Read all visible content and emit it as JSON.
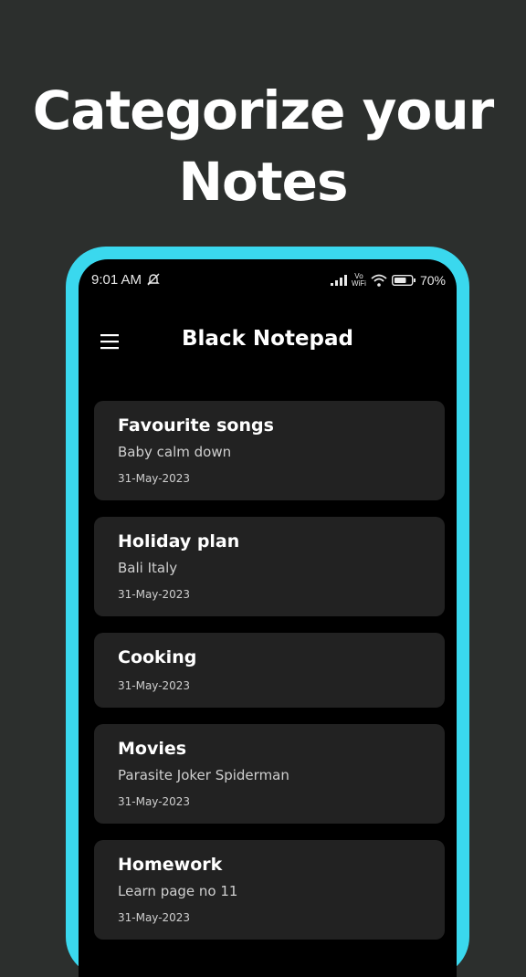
{
  "headline": {
    "line1": "Categorize your",
    "line2": "Notes"
  },
  "status": {
    "time": "9:01 AM",
    "vowifi_top": "Vo",
    "vowifi_bottom": "WiFi",
    "battery": "70%"
  },
  "app": {
    "title": "Black Notepad"
  },
  "notes": [
    {
      "title": "Favourite songs",
      "body": "Baby calm down",
      "date": "31-May-2023"
    },
    {
      "title": "Holiday plan",
      "body": "Bali Italy",
      "date": "31-May-2023"
    },
    {
      "title": "Cooking",
      "body": "",
      "date": "31-May-2023"
    },
    {
      "title": "Movies",
      "body": "Parasite Joker Spiderman",
      "date": "31-May-2023"
    },
    {
      "title": "Homework",
      "body": "Learn page no 11",
      "date": "31-May-2023"
    }
  ],
  "colors": {
    "background": "#2c2f2d",
    "phone_frame": "#3ad8ee",
    "card": "#222222",
    "screen": "#000000"
  },
  "icons": {
    "menu": "hamburger-menu-icon",
    "mute": "bell-off-icon",
    "signal": "signal-icon",
    "wifi": "wifi-icon",
    "battery": "battery-icon"
  }
}
